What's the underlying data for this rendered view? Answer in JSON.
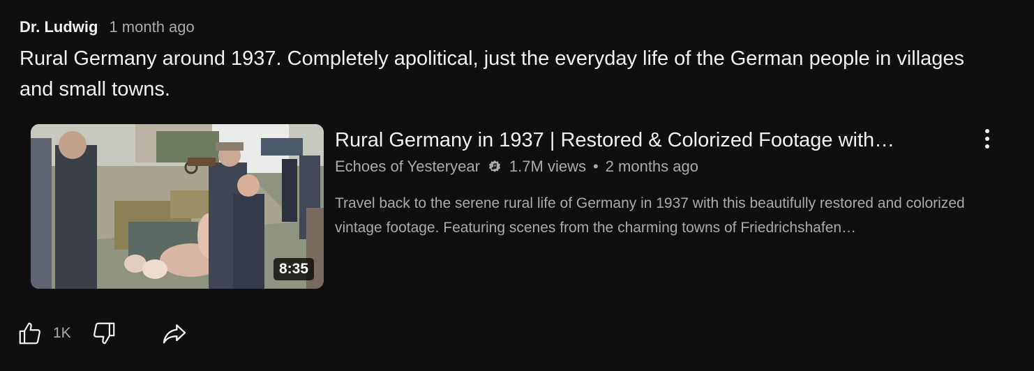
{
  "comment": {
    "author": "Dr. Ludwig",
    "time": "1 month ago",
    "text": "Rural Germany around 1937. Completely apolitical, just the everyday life of the German people in villages and small towns."
  },
  "video": {
    "title": "Rural Germany in 1937 | Restored & Colorized Footage with…",
    "channel": "Echoes of Yesteryear",
    "views": "1.7M views",
    "separator": "•",
    "age": "2 months ago",
    "description": "Travel back to the serene rural life of Germany in 1937 with this beautifully restored and colorized vintage footage. Featuring scenes from the charming towns of Friedrichshafen…",
    "duration": "8:35"
  },
  "actions": {
    "like_count": "1K"
  },
  "icons": {
    "like": "thumbs-up-icon",
    "dislike": "thumbs-down-icon",
    "share": "share-icon",
    "more": "more-vertical-icon",
    "verified": "music-verified-icon"
  },
  "colors": {
    "background": "#0f0f0f",
    "primary_text": "#f1f1f1",
    "secondary_text": "#aaaaaa"
  }
}
